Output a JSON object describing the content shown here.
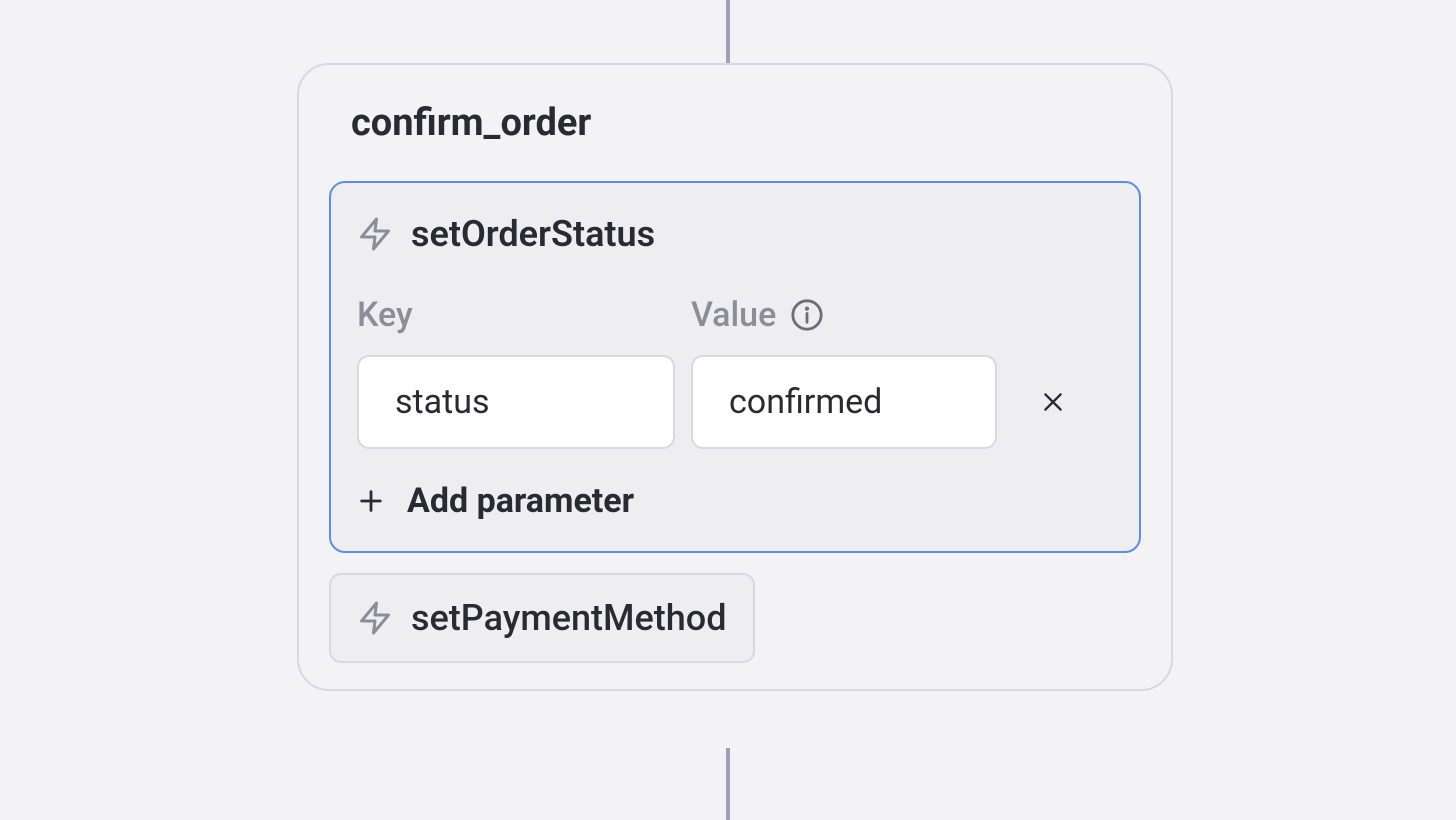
{
  "node": {
    "title": "confirm_order",
    "actions": [
      {
        "name": "setOrderStatus",
        "selected": true,
        "labels": {
          "key": "Key",
          "value": "Value",
          "addParameter": "Add parameter"
        },
        "parameters": [
          {
            "key": "status",
            "value": "confirmed"
          }
        ]
      },
      {
        "name": "setPaymentMethod",
        "selected": false
      }
    ]
  }
}
